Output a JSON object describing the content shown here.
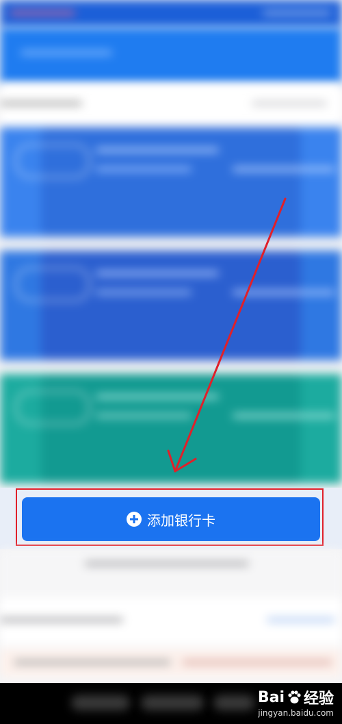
{
  "add_card": {
    "label": "添加银行卡",
    "icon": "plus-circle-icon"
  },
  "watermark": {
    "brand": "Bai",
    "brand_suffix": "经验",
    "domain": "jingyan.baidu.com"
  },
  "colors": {
    "primary": "#1b73f0",
    "header": "#1f7cf0",
    "highlight": "#e0202a",
    "arrow": "#e0202a",
    "card_1": "#2d78e6",
    "card_2": "#2f6fd6",
    "card_3": "#16a39a"
  }
}
